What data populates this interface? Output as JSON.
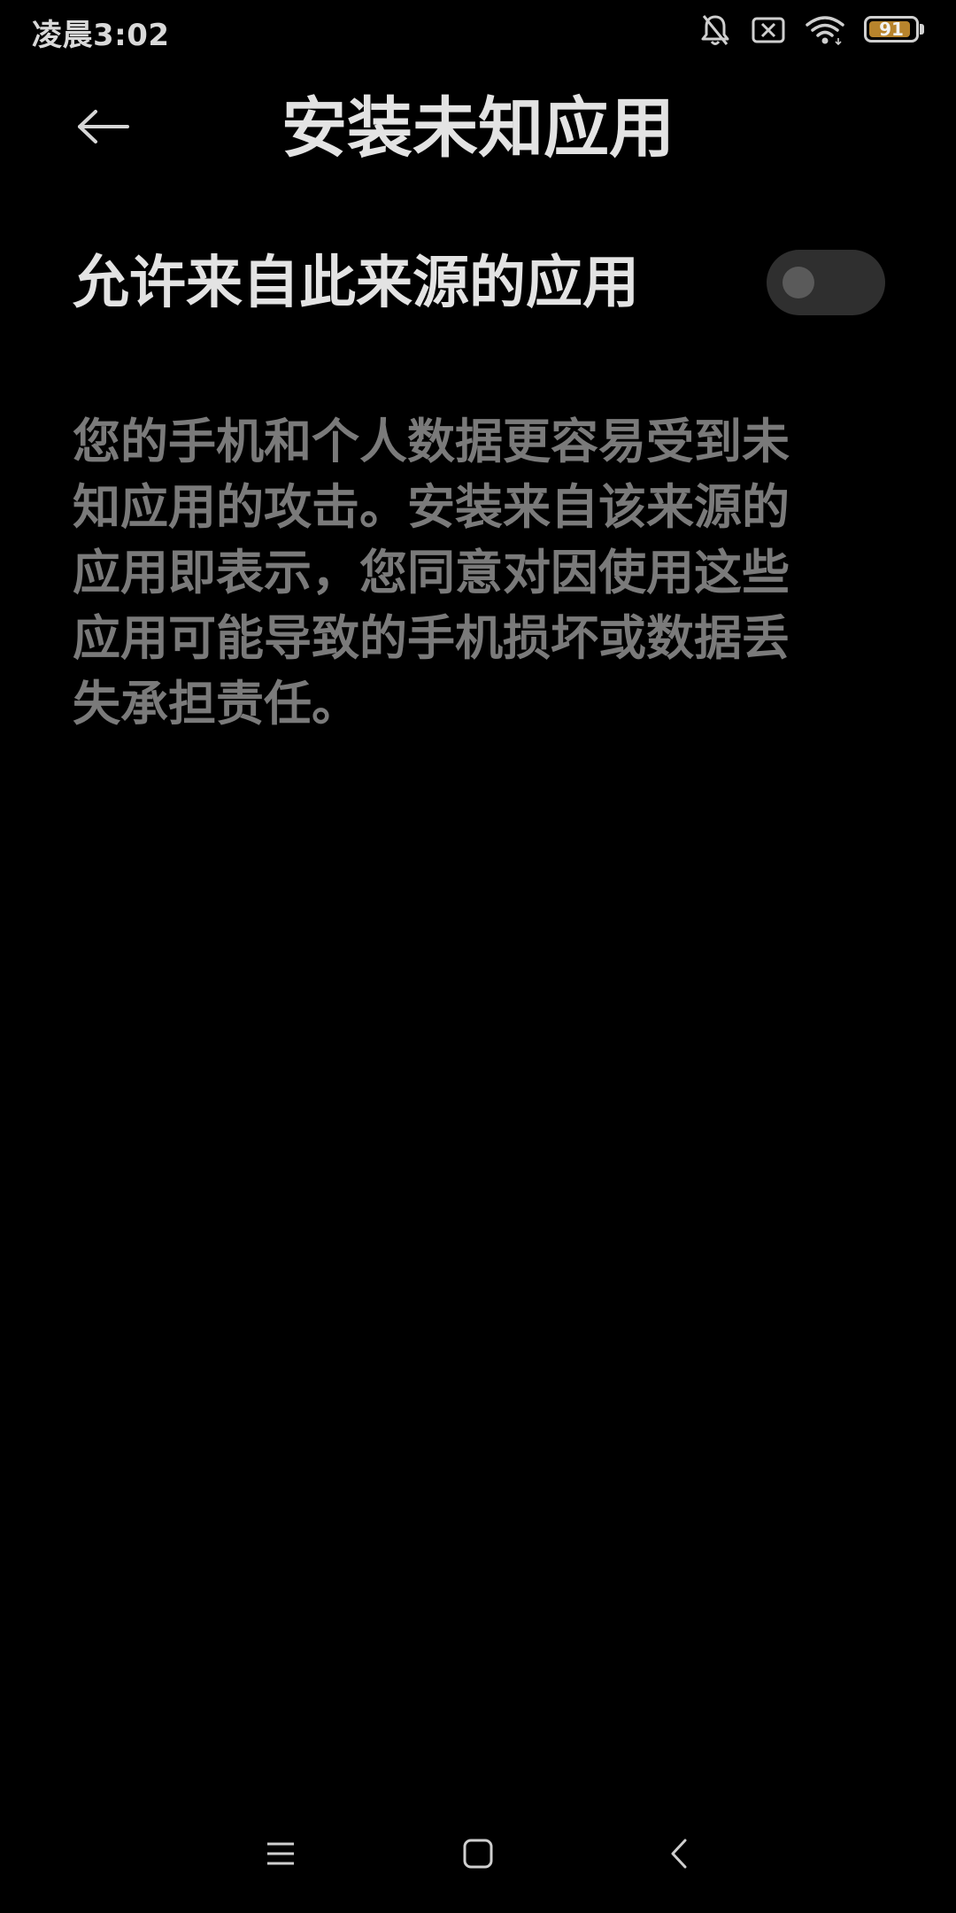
{
  "status_bar": {
    "time": "凌晨3:02",
    "battery_level": "91",
    "battery_fraction": 0.91,
    "icons": [
      "bell-off-icon",
      "sim-error-icon",
      "wifi-icon",
      "battery-icon"
    ]
  },
  "header": {
    "title": "安装未知应用",
    "back_icon": "arrow-left-icon"
  },
  "setting": {
    "label": "允许来自此来源的应用",
    "toggle_state": "off"
  },
  "description": "您的手机和个人数据更容易受到未知应用的攻击。安装来自该来源的应用即表示，您同意对因使用这些应用可能导致的手机损坏或数据丢失承担责任。",
  "nav_bar": {
    "icons": [
      "menu-icon",
      "home-icon",
      "back-icon"
    ]
  },
  "colors": {
    "background": "#000000",
    "title_text": "#e3e3e3",
    "description_text": "#7a7a7a",
    "toggle_track": "#2f2f2f",
    "toggle_knob": "#5a5a5a",
    "battery_fill": "#b8842c"
  }
}
